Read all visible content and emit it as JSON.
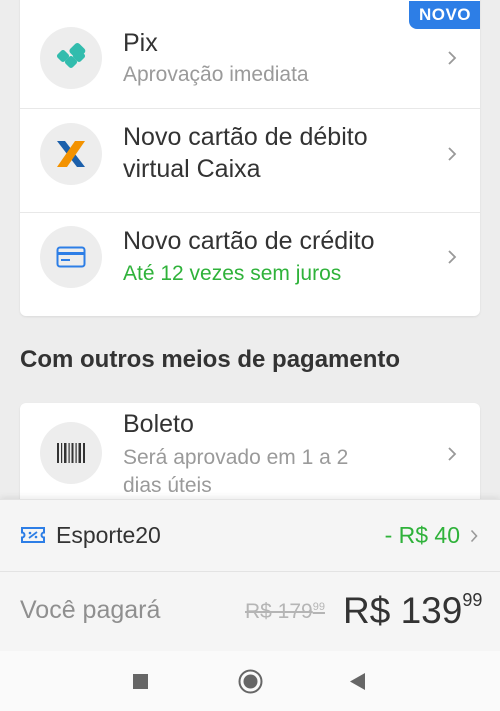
{
  "payment_methods": {
    "badge": "NOVO",
    "items": [
      {
        "title": "Pix",
        "subtitle": "Aprovação imediata",
        "icon": "pix-icon"
      },
      {
        "title_line1": "Novo cartão de débito",
        "title_line2": "virtual Caixa",
        "icon": "caixa-logo-icon"
      },
      {
        "title": "Novo cartão de crédito",
        "subtitle": "Até 12 vezes sem juros",
        "icon": "credit-card-icon"
      }
    ]
  },
  "other_methods": {
    "heading": "Com outros meios de pagamento",
    "items": [
      {
        "title": "Boleto",
        "subtitle_line1": "Será aprovado em 1 a 2",
        "subtitle_line2": "dias úteis",
        "icon": "barcode-icon"
      }
    ]
  },
  "summary": {
    "coupon": {
      "code": "Esporte20",
      "discount": "- R$ 40",
      "icon": "ticket-icon"
    },
    "pay_label": "Você pagará",
    "old_price_main": "R$ 179",
    "old_price_cents": "99",
    "new_price_main": "R$ 139",
    "new_price_cents": "99"
  },
  "colors": {
    "accent_blue": "#2d7ee6",
    "success_green": "#2fb23a",
    "pix_teal": "#32bcad",
    "caixa_orange": "#f39200",
    "caixa_blue": "#1c60ab"
  }
}
